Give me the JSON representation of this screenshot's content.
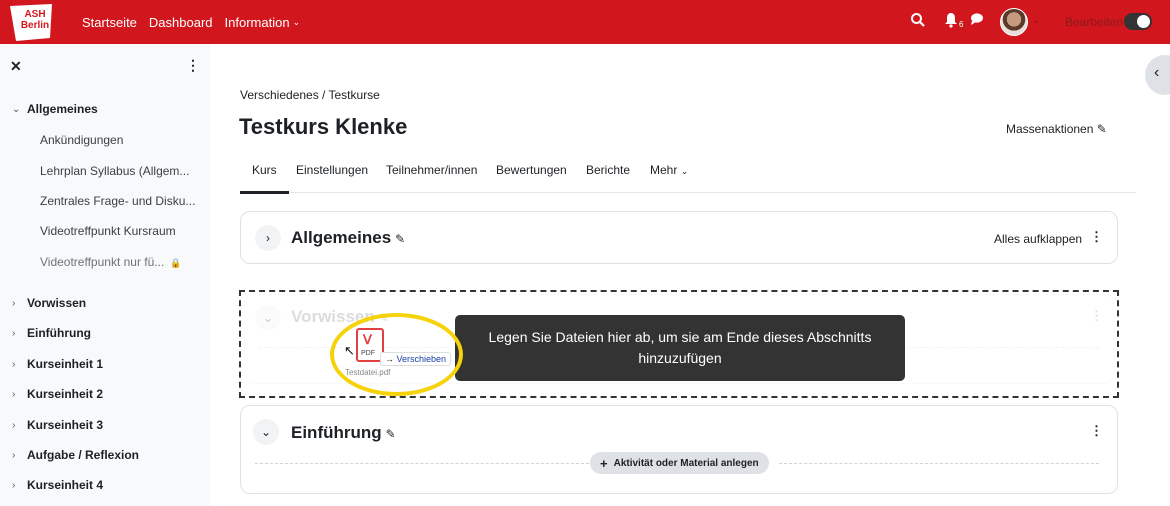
{
  "topbar": {
    "logo_text_1": "ASH",
    "logo_text_2": "Berlin",
    "nav": [
      "Startseite",
      "Dashboard",
      "Information"
    ],
    "notification_count": "6",
    "edit_mode_label": "Bearbeiten",
    "edit_mode_on": true,
    "brand_color": "#d2161e"
  },
  "drawer": {
    "sections": [
      {
        "label": "Allgemeines",
        "expanded": true,
        "items": [
          {
            "label": "Ankündigungen"
          },
          {
            "label": "Lehrplan Syllabus (Allgem..."
          },
          {
            "label": "Zentrales Frage- und Disku..."
          },
          {
            "label": "Videotreffpunkt Kursraum"
          },
          {
            "label": "Videotreffpunkt nur fü...",
            "locked": true
          }
        ]
      },
      {
        "label": "Vorwissen"
      },
      {
        "label": "Einführung"
      },
      {
        "label": "Kurseinheit 1"
      },
      {
        "label": "Kurseinheit 2"
      },
      {
        "label": "Kurseinheit 3"
      },
      {
        "label": "Aufgabe / Reflexion"
      },
      {
        "label": "Kurseinheit 4"
      }
    ]
  },
  "breadcrumb": "Verschiedenes  /  Testkurse",
  "page_title": "Testkurs Klenke",
  "bulk_actions_label": "Massenaktionen",
  "tabs": [
    "Kurs",
    "Einstellungen",
    "Teilnehmer/innen",
    "Bewertungen",
    "Berichte",
    "Mehr"
  ],
  "course_sections": [
    {
      "title": "Allgemeines",
      "collapsed": true,
      "action": "Alles aufklappen"
    },
    {
      "title": "Vorwissen",
      "drop_target": true
    },
    {
      "title": "Einführung",
      "add_label": "Aktivität oder Material anlegen"
    }
  ],
  "drop_tooltip": "Legen Sie Dateien hier ab, um sie am Ende dieses Abschnitts hinzuzufügen",
  "drag": {
    "file_type": "PDF",
    "file_name": "Testdatei.pdf",
    "move_label": "Verschieben"
  }
}
